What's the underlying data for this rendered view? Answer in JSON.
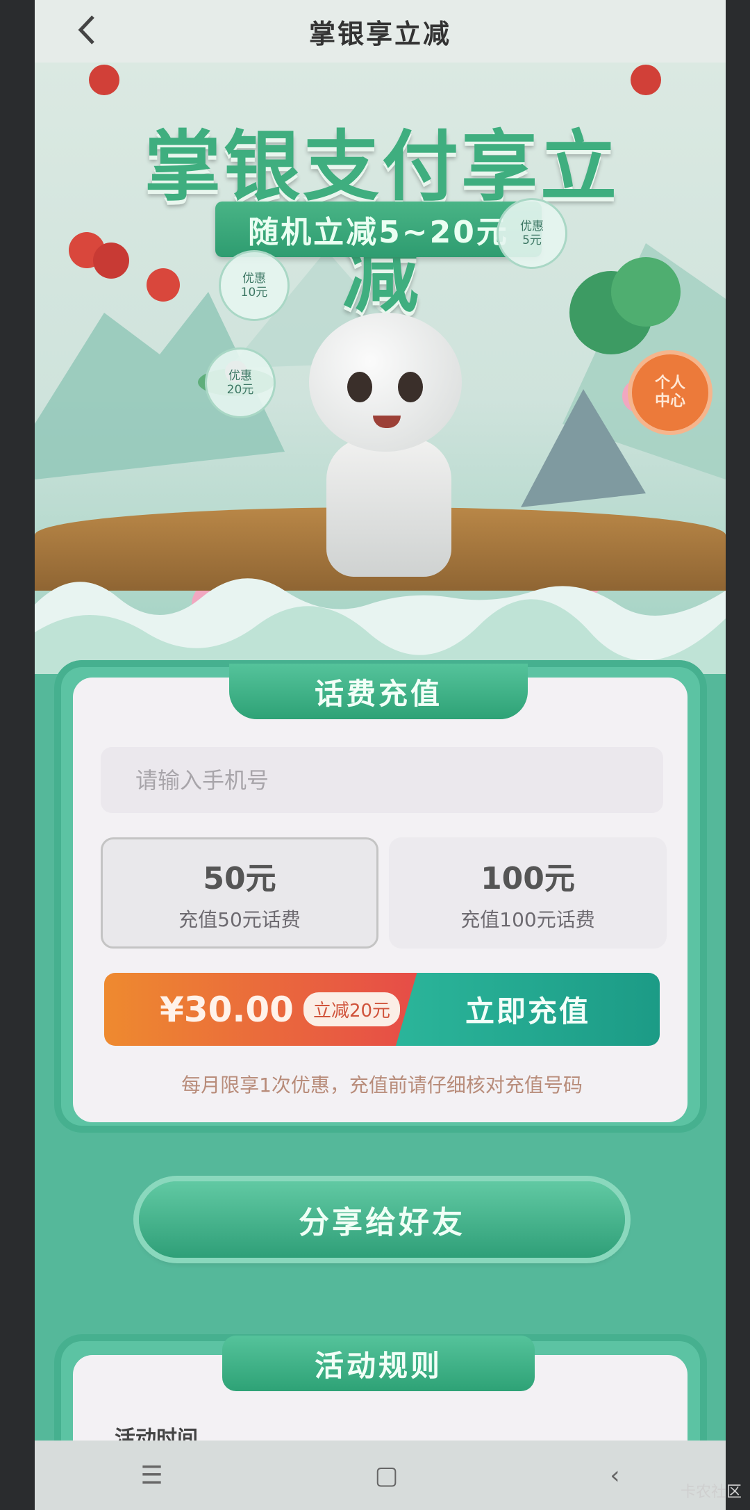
{
  "header": {
    "title": "掌银享立减",
    "back_icon": "chevron-left-icon"
  },
  "banner": {
    "title": "掌银支付享立减",
    "subtitle": "随机立减5~20元",
    "bubbles": [
      {
        "label": "优惠",
        "amount": "10元"
      },
      {
        "label": "优惠",
        "amount": "20元"
      },
      {
        "label": "优惠",
        "amount": "5元"
      }
    ],
    "badge": {
      "line1": "个人",
      "line2": "中心"
    }
  },
  "recharge": {
    "section_title": "话费充值",
    "phone_placeholder": "请输入手机号",
    "options": [
      {
        "price": "50元",
        "desc": "充值50元话费",
        "selected": true
      },
      {
        "price": "100元",
        "desc": "充值100元话费",
        "selected": false
      }
    ],
    "pay_amount": "¥30.00",
    "discount_tag": "立减20元",
    "pay_button": "立即充值",
    "notice": "每月限享1次优惠，充值前请仔细核对充值号码"
  },
  "share_button": "分享给好友",
  "rules": {
    "section_title": "活动规则",
    "first_line": "活动时间"
  },
  "navbar": {
    "menu_icon": "☰",
    "home_icon": "▢",
    "back_icon": "‹"
  },
  "watermark": "卡农社区",
  "colors": {
    "primary_green": "#2e9c70",
    "pay_orange": "#ee8a2f",
    "pay_red": "#e64b48",
    "pay_teal": "#1c9b86"
  }
}
